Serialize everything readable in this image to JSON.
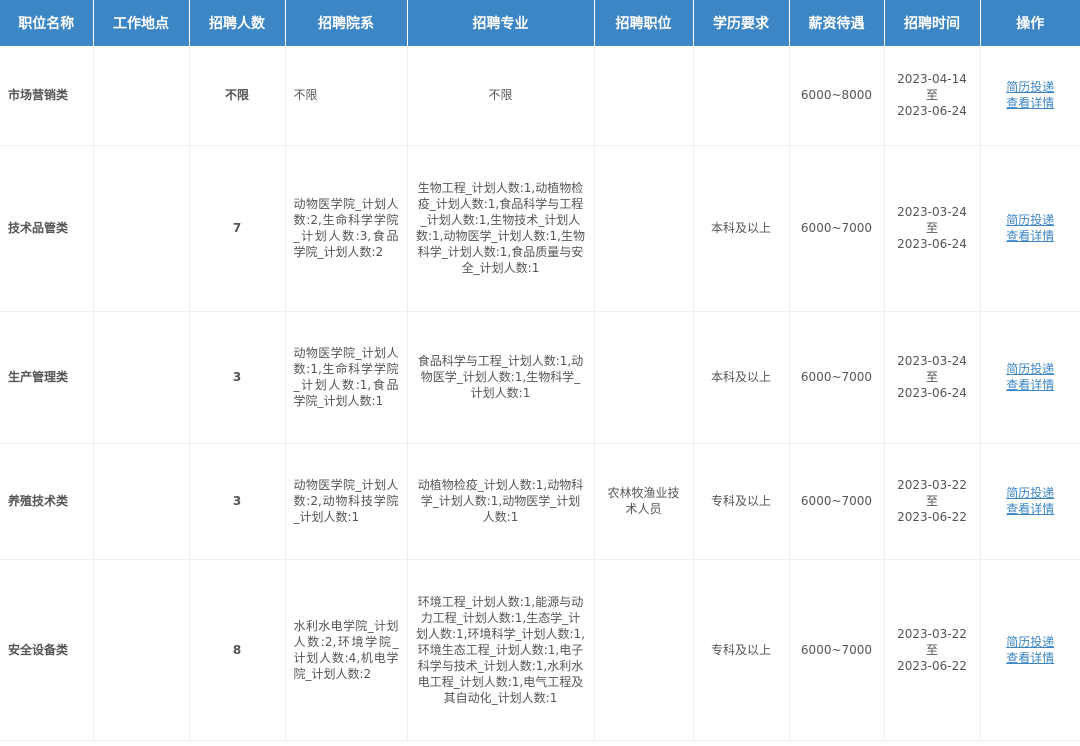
{
  "table": {
    "headers": [
      "职位名称",
      "工作地点",
      "招聘人数",
      "招聘院系",
      "招聘专业",
      "招聘职位",
      "学历要求",
      "薪资待遇",
      "招聘时间",
      "操作"
    ],
    "time_separator": "至",
    "actions": {
      "apply": "简历投递",
      "detail": "查看详情"
    },
    "rows": [
      {
        "name": "市场营销类",
        "location": "",
        "count": "不限",
        "dept": "不限",
        "major": "不限",
        "position": "",
        "education": "",
        "salary": "6000~8000",
        "start": "2023-04-14",
        "end": "2023-06-24"
      },
      {
        "name": "技术品管类",
        "location": "",
        "count": "7",
        "dept": "动物医学院_计划人数:2,生命科学学院_计划人数:3,食品学院_计划人数:2",
        "major": "生物工程_计划人数:1,动植物检疫_计划人数:1,食品科学与工程_计划人数:1,生物技术_计划人数:1,动物医学_计划人数:1,生物科学_计划人数:1,食品质量与安全_计划人数:1",
        "position": "",
        "education": "本科及以上",
        "salary": "6000~7000",
        "start": "2023-03-24",
        "end": "2023-06-24"
      },
      {
        "name": "生产管理类",
        "location": "",
        "count": "3",
        "dept": "动物医学院_计划人数:1,生命科学学院_计划人数:1,食品学院_计划人数:1",
        "major": "食品科学与工程_计划人数:1,动物医学_计划人数:1,生物科学_计划人数:1",
        "position": "",
        "education": "本科及以上",
        "salary": "6000~7000",
        "start": "2023-03-24",
        "end": "2023-06-24"
      },
      {
        "name": "养殖技术类",
        "location": "",
        "count": "3",
        "dept": "动物医学院_计划人数:2,动物科技学院_计划人数:1",
        "major": "动植物检疫_计划人数:1,动物科学_计划人数:1,动物医学_计划人数:1",
        "position": "农林牧渔业技术人员",
        "education": "专科及以上",
        "salary": "6000~7000",
        "start": "2023-03-22",
        "end": "2023-06-22"
      },
      {
        "name": "安全设备类",
        "location": "",
        "count": "8",
        "dept": "水利水电学院_计划人数:2,环境学院_计划人数:4,机电学院_计划人数:2",
        "major": "环境工程_计划人数:1,能源与动力工程_计划人数:1,生态学_计划人数:1,环境科学_计划人数:1,环境生态工程_计划人数:1,电子科学与技术_计划人数:1,水利水电工程_计划人数:1,电气工程及其自动化_计划人数:1",
        "position": "",
        "education": "专科及以上",
        "salary": "6000~7000",
        "start": "2023-03-22",
        "end": "2023-06-22"
      }
    ]
  }
}
